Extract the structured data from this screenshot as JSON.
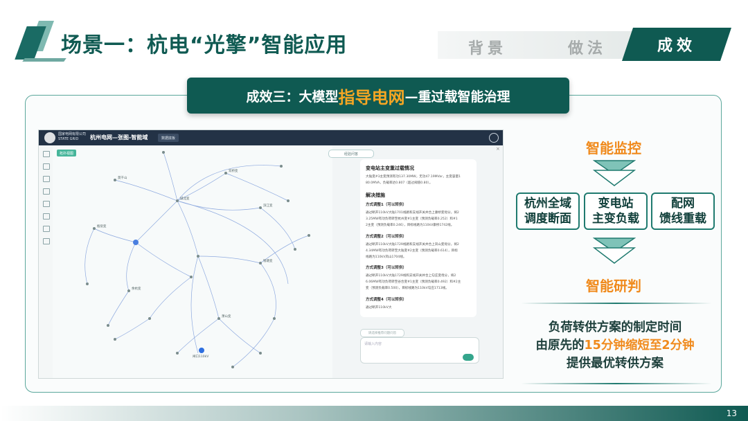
{
  "header": {
    "title": "场景一：杭电“光擎”智能应用",
    "tabs": [
      "背景",
      "做法",
      "成效"
    ],
    "active_tab": "成效",
    "accent": "#0f5a52",
    "highlight": "#f08a1c"
  },
  "banner": {
    "prefix": "成效三：大模型",
    "highlight": "指导电网",
    "suffix": "—重过载智能治理"
  },
  "screenshot": {
    "org_line1": "国家电网有限公司",
    "org_line2": "STATE GRID",
    "app_title": "杭州电网—张图-智能域",
    "top_button": "数据底板",
    "map_tag": "拓扑视图",
    "node_labels": [
      "莫干山",
      "城北变",
      "双桥变",
      "滨江变",
      "钱塘变",
      "萧山变",
      "瓶窑变",
      "余杭变",
      "闸口110kV"
    ],
    "chat_pill": "经验问答",
    "chat": {
      "title": "变电站主变重过载情况",
      "summary": [
        "大陆变#3主变预测有功137.30MW，无功47.19MVar，主变容量1",
        "80.0MVA，负载率达0.807（超过阈值0.80）。"
      ],
      "measures_title": "解决措施",
      "plans": [
        {
          "title": "方式调整1（可以转供）",
          "lines": [
            "通过断开110kV大陆1701线路和支线开关并合上康桥变母分，将2",
            "3.25MW有功负荷转至杭州变#1主变（预测负载率0.252）和#1",
            "2主变（预测负载率0.246），目标线路为110kV康桥1742线。"
          ]
        },
        {
          "title": "方式调整2（可以转供）",
          "lines": [
            "通过断开110kV大陆1729线路和支线开关并合上凤山变母分，将2",
            "4.34MW有功负荷转至大陆变#2主变（预测负载率0.614），目标",
            "线路为110kV凤山1704线。"
          ]
        },
        {
          "title": "方式调整3（可以转供）",
          "lines": [
            "通过断开110kV大陆1729线和支线开关并合上勾庄变母分，将2",
            "6.06MW有功负荷转至谷合变#1主变（预测负载率0.492）和#2主",
            "变（预测负载率0.500），目标线路为110kV勾庄1713线。"
          ]
        },
        {
          "title": "方式调整4（可以转供）",
          "lines": [
            "通过断开110kV大"
          ]
        }
      ],
      "input_pill": "请选择推荐问题问答",
      "input_placeholder": "请输入内容"
    }
  },
  "right": {
    "monitor_title": "智能监控",
    "boxes": [
      [
        "杭州全域",
        "调度断面"
      ],
      [
        "变电站",
        "主变负载"
      ],
      [
        "配网",
        "馈线重载"
      ]
    ],
    "judge_title": "智能研判",
    "result_line1": "负荷转供方案的制定时间",
    "result_line2_prefix": "由原先的",
    "result_line2_highlight": "15分钟缩短至2分钟",
    "result_line3": "提供最优转供方案"
  },
  "page_number": "13"
}
